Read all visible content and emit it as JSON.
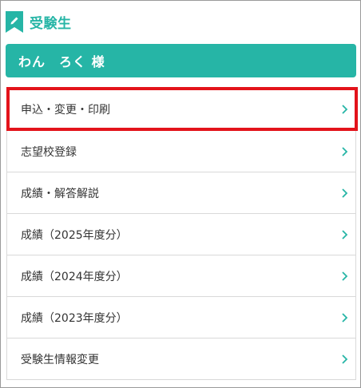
{
  "header": {
    "title": "受験生",
    "icon": "pencil-bookmark-icon"
  },
  "user": {
    "name": "わん　ろく 様"
  },
  "menu": {
    "items": [
      {
        "label": "申込・変更・印刷",
        "highlighted": true
      },
      {
        "label": "志望校登録"
      },
      {
        "label": "成績・解答解説"
      },
      {
        "label": "成績（2025年度分）"
      },
      {
        "label": "成績（2024年度分）"
      },
      {
        "label": "成績（2023年度分）"
      },
      {
        "label": "受験生情報変更"
      }
    ]
  },
  "colors": {
    "accent": "#26b5a6",
    "highlight": "#e3131b",
    "border": "#d9d9d9"
  }
}
